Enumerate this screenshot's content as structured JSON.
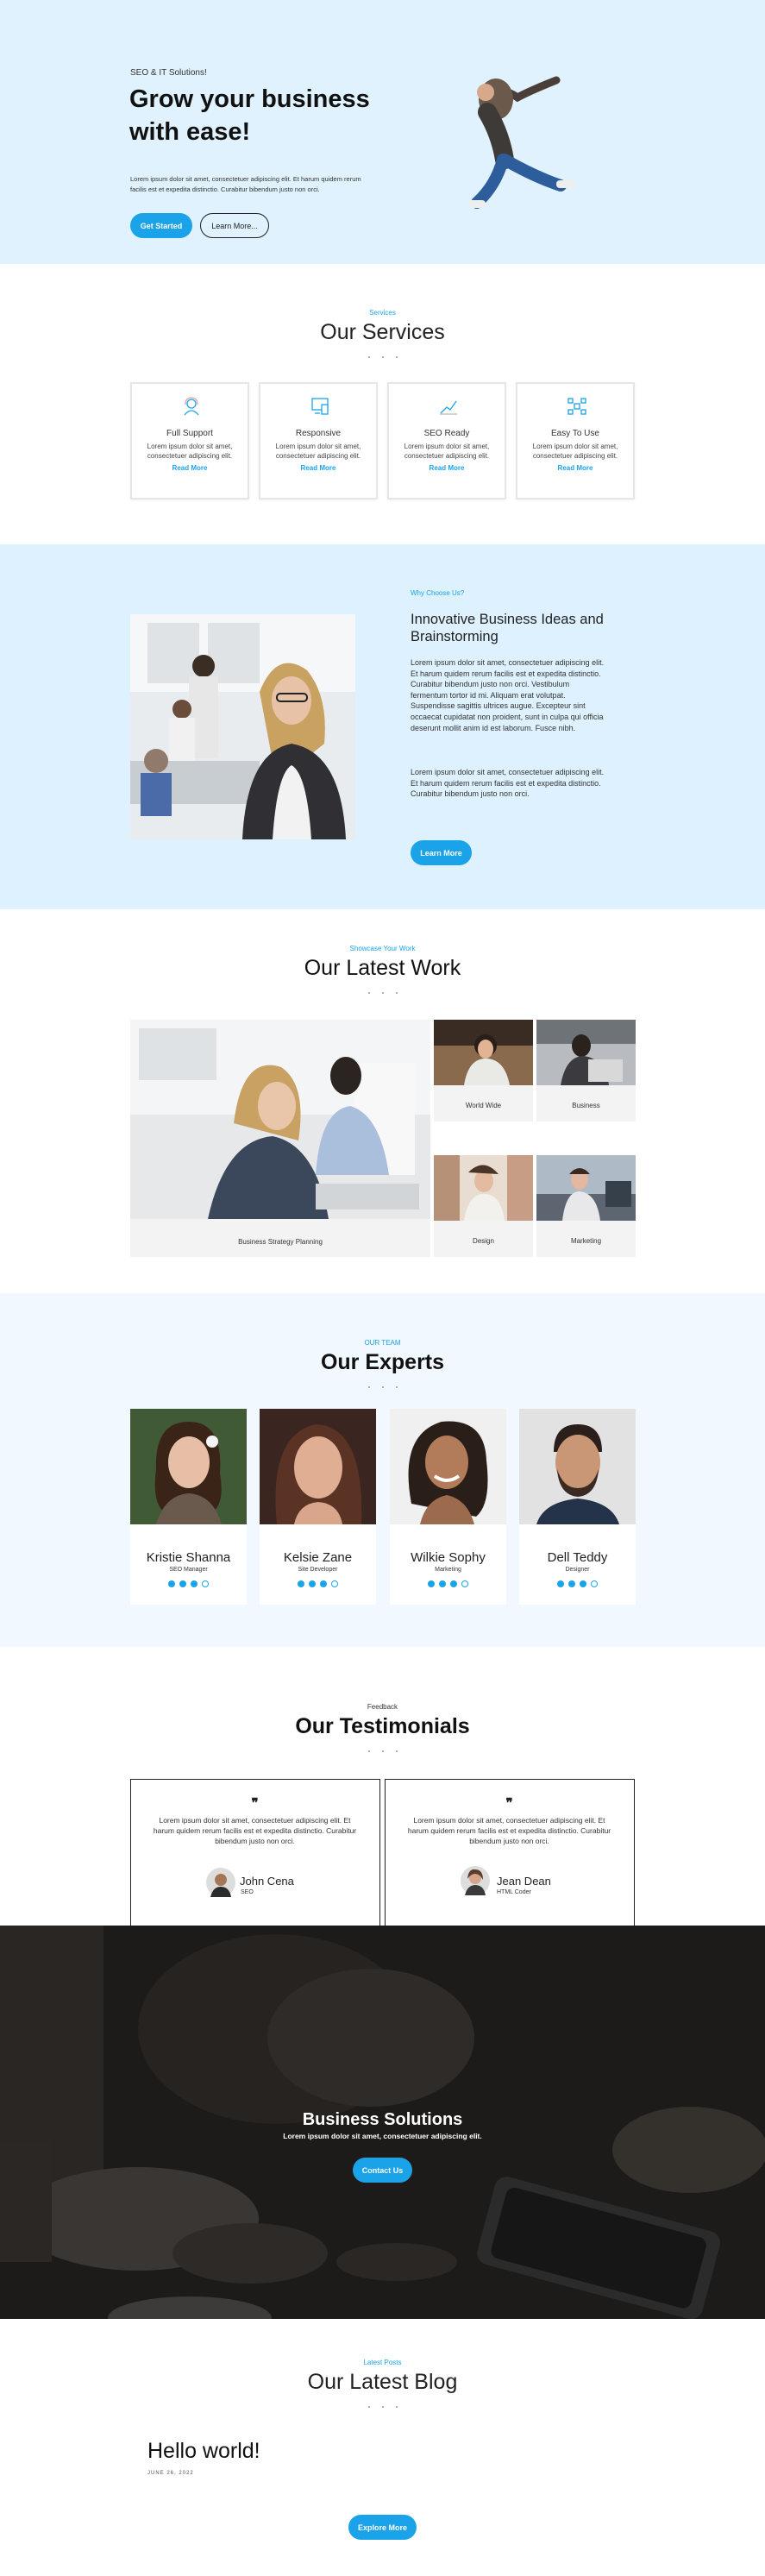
{
  "hero": {
    "eyebrow": "SEO & IT Solutions!",
    "title_line1": "Grow your business",
    "title_line2": "with ease!",
    "text_line1": "Lorem ipsum dolor sit amet, consectetuer adipiscing elit. Et harum quidem rerum",
    "text_line2": "facilis est et expedita distinctio. Curabitur bibendum justo non orci.",
    "primary_button": "Get Started",
    "secondary_button": "Learn More..."
  },
  "services": {
    "eyebrow": "Services",
    "title": "Our Services",
    "items": [
      {
        "title": "Full Support",
        "text1": "Lorem ipsum dolor sit amet,",
        "text2": "consectetuer adipiscing elit.",
        "link": "Read More",
        "icon": "support-icon"
      },
      {
        "title": "Responsive",
        "text1": "Lorem ipsum dolor sit amet,",
        "text2": "consectetuer adipiscing elit.",
        "link": "Read More",
        "icon": "responsive-icon"
      },
      {
        "title": "SEO Ready",
        "text1": "Lorem ipsum dolor sit amet,",
        "text2": "consectetuer adipiscing elit.",
        "link": "Read More",
        "icon": "chart-icon"
      },
      {
        "title": "Easy To Use",
        "text1": "Lorem ipsum dolor sit amet,",
        "text2": "consectetuer adipiscing elit.",
        "link": "Read More",
        "icon": "network-icon"
      }
    ]
  },
  "why": {
    "eyebrow": "Why Choose Us?",
    "title_line1": "Innovative Business Ideas and",
    "title_line2": "Brainstorming",
    "p1": [
      "Lorem ipsum dolor sit amet, consectetuer adipiscing elit.",
      "Et harum quidem rerum facilis est et expedita distinctio.",
      "Curabitur bibendum justo non orci. Vestibulum",
      "fermentum tortor id mi. Aliquam erat volutpat.",
      "Suspendisse sagittis ultrices augue. Excepteur sint",
      "occaecat cupidatat non proident, sunt in culpa qui officia",
      "deserunt mollit anim id est laborum. Fusce nibh."
    ],
    "p2": [
      "Lorem ipsum dolor sit amet, consectetuer adipiscing elit.",
      "Et harum quidem rerum facilis est et expedita distinctio.",
      "Curabitur bibendum justo non orci."
    ],
    "button": "Learn More"
  },
  "work": {
    "eyebrow": "Showcase Your Work",
    "title": "Our Latest Work",
    "big_caption": "Business Strategy Planning",
    "items": [
      "World Wide",
      "Business",
      "Design",
      "Marketing"
    ]
  },
  "team": {
    "eyebrow": "OUR TEAM",
    "title": "Our Experts",
    "members": [
      {
        "name": "Kristie Shanna",
        "role": "SEO Manager"
      },
      {
        "name": "Kelsie Zane",
        "role": "Site Developer"
      },
      {
        "name": "Wilkie Sophy",
        "role": "Marketing"
      },
      {
        "name": "Dell Teddy",
        "role": "Designer"
      }
    ]
  },
  "testimonials": {
    "eyebrow": "Feedback",
    "title": "Our Testimonials",
    "quote_mark": "❞",
    "items": [
      {
        "text1": "Lorem ipsum dolor sit amet, consectetuer adipiscing elit. Et",
        "text2": "harum quidem rerum facilis est et expedita distinctio. Curabitur",
        "text3": "bibendum justo non orci.",
        "name": "John Cena",
        "role": "SEO"
      },
      {
        "text1": "Lorem ipsum dolor sit amet, consectetuer adipiscing elit. Et",
        "text2": "harum quidem rerum facilis est et expedita distinctio. Curabitur",
        "text3": "bibendum justo non orci.",
        "name": "Jean Dean",
        "role": "HTML Coder"
      }
    ]
  },
  "cta": {
    "title": "Business Solutions",
    "subtitle": "Lorem ipsum dolor sit amet, consectetuer adipiscing elit.",
    "button": "Contact Us"
  },
  "blog": {
    "eyebrow": "Latest Posts",
    "title": "Our Latest Blog",
    "post_title": "Hello world!",
    "post_date": "JUNE 26, 2022",
    "button": "Explore More"
  },
  "colors": {
    "accent": "#1aa3e8",
    "hero_bg": "#dff2fe",
    "why_bg": "#ddf1fe",
    "team_bg": "#f1f8ff",
    "cta_bg": "#1e1e1e"
  }
}
